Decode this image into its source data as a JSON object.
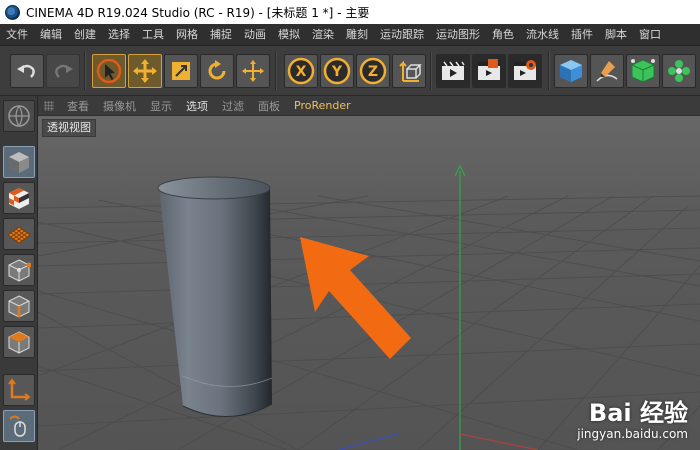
{
  "window": {
    "title": "CINEMA 4D R19.024 Studio (RC - R19) - [未标题 1 *] - 主要"
  },
  "menubar": {
    "items": [
      "文件",
      "编辑",
      "创建",
      "选择",
      "工具",
      "网格",
      "捕捉",
      "动画",
      "模拟",
      "渲染",
      "雕刻",
      "运动跟踪",
      "运动图形",
      "角色",
      "流水线",
      "插件",
      "脚本",
      "窗口"
    ]
  },
  "toolbar": {
    "buttons": [
      "undo-icon",
      "redo-icon",
      "live-selection-icon",
      "move-icon",
      "scale-icon",
      "rotate-icon",
      "recent-tools-icon",
      "x-axis-lock-icon",
      "y-axis-lock-icon",
      "z-axis-lock-icon",
      "coordinate-system-icon",
      "render-view-icon",
      "render-picture-viewer-icon",
      "render-settings-icon",
      "cube-icon",
      "pen-icon",
      "subdivision-icon",
      "cloner-icon"
    ],
    "axis_labels": {
      "x": "X",
      "y": "Y",
      "z": "Z"
    }
  },
  "leftbar": {
    "buttons": [
      "viewport-solo-icon",
      "model-mode-icon",
      "texture-mode-icon",
      "workplane-icon",
      "points-mode-icon",
      "edges-mode-icon",
      "polygons-mode-icon",
      "axis-mode-icon",
      "tweak-mode-icon"
    ]
  },
  "viewport": {
    "menu": [
      "查看",
      "摄像机",
      "显示",
      "选项",
      "过滤",
      "面板",
      "ProRender"
    ],
    "active_menu": "选项",
    "label": "透视视图"
  },
  "watermark": {
    "brand": "Bai 经验",
    "url": "jingyan.baidu.com"
  },
  "colors": {
    "accent": "#d3a040",
    "arrow": "#f26b12",
    "y_axis": "#2fa84a"
  }
}
